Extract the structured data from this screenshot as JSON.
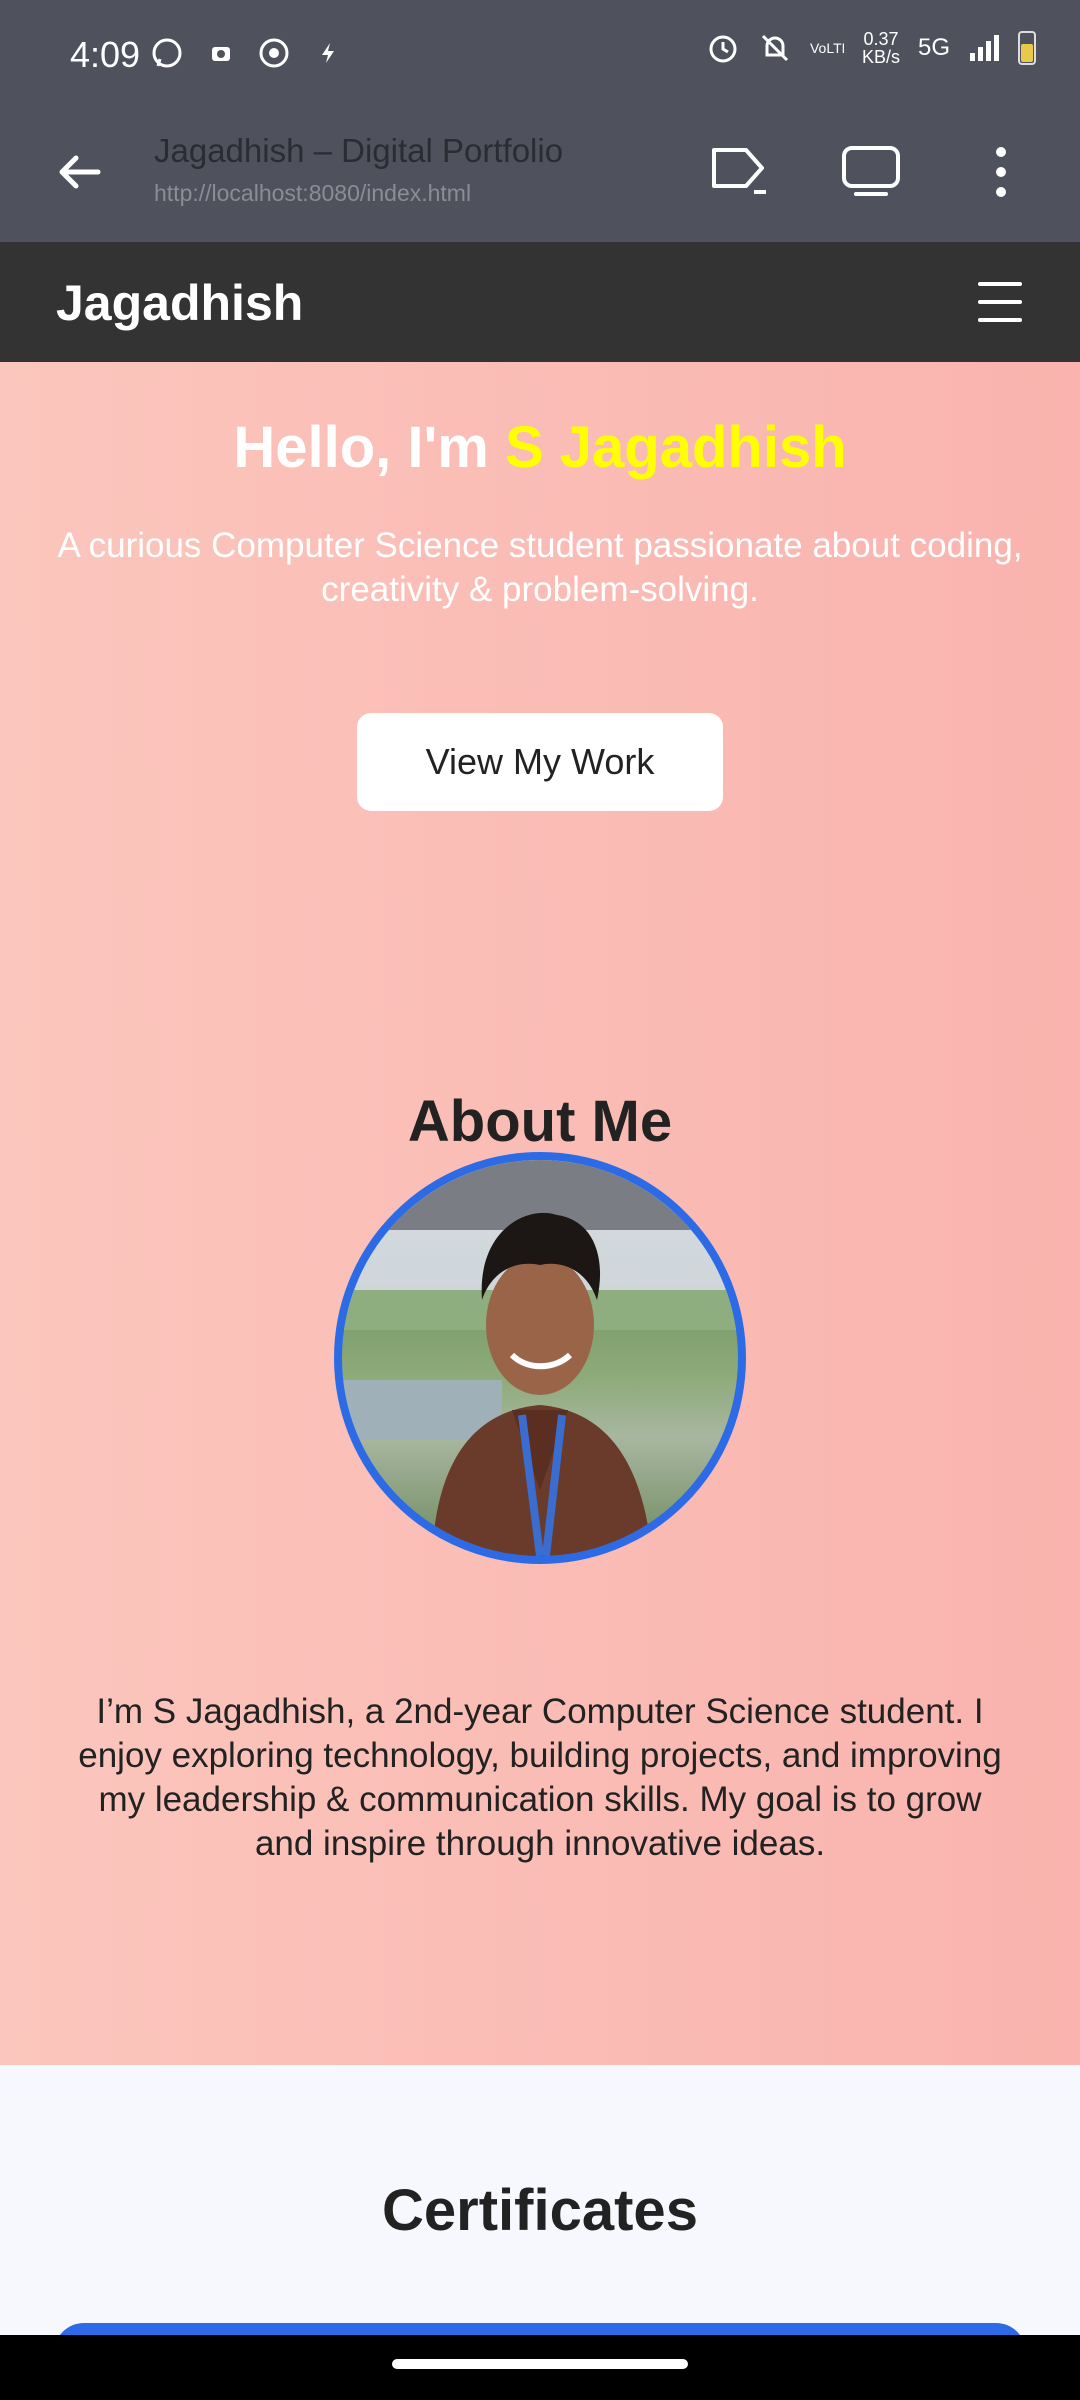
{
  "status_bar": {
    "time": "4:09",
    "net_speed_top": "0.37",
    "net_speed_bottom": "KB/s",
    "network": "5G",
    "volte": "VoLTE"
  },
  "browser": {
    "title": "Jagadhish – Digital Portfolio",
    "url": "http://localhost:8080/index.html"
  },
  "site_nav": {
    "brand": "Jagadhish"
  },
  "hero": {
    "greeting": "Hello, I'm",
    "name": "S Jagadhish",
    "subtitle": "A curious Computer Science student passionate about coding, creativity & problem-solving.",
    "cta_label": "View My Work"
  },
  "about": {
    "title": "About Me",
    "text": "I’m S Jagadhish, a 2nd-year Computer Science student. I enjoy exploring technology, building projects, and improving my leadership & communication skills. My goal is to grow and inspire through innovative ideas."
  },
  "certificates": {
    "title": "Certificates"
  },
  "colors": {
    "accent_yellow": "#ffff00",
    "avatar_border": "#2d6be6",
    "nav_bg": "#333333"
  }
}
